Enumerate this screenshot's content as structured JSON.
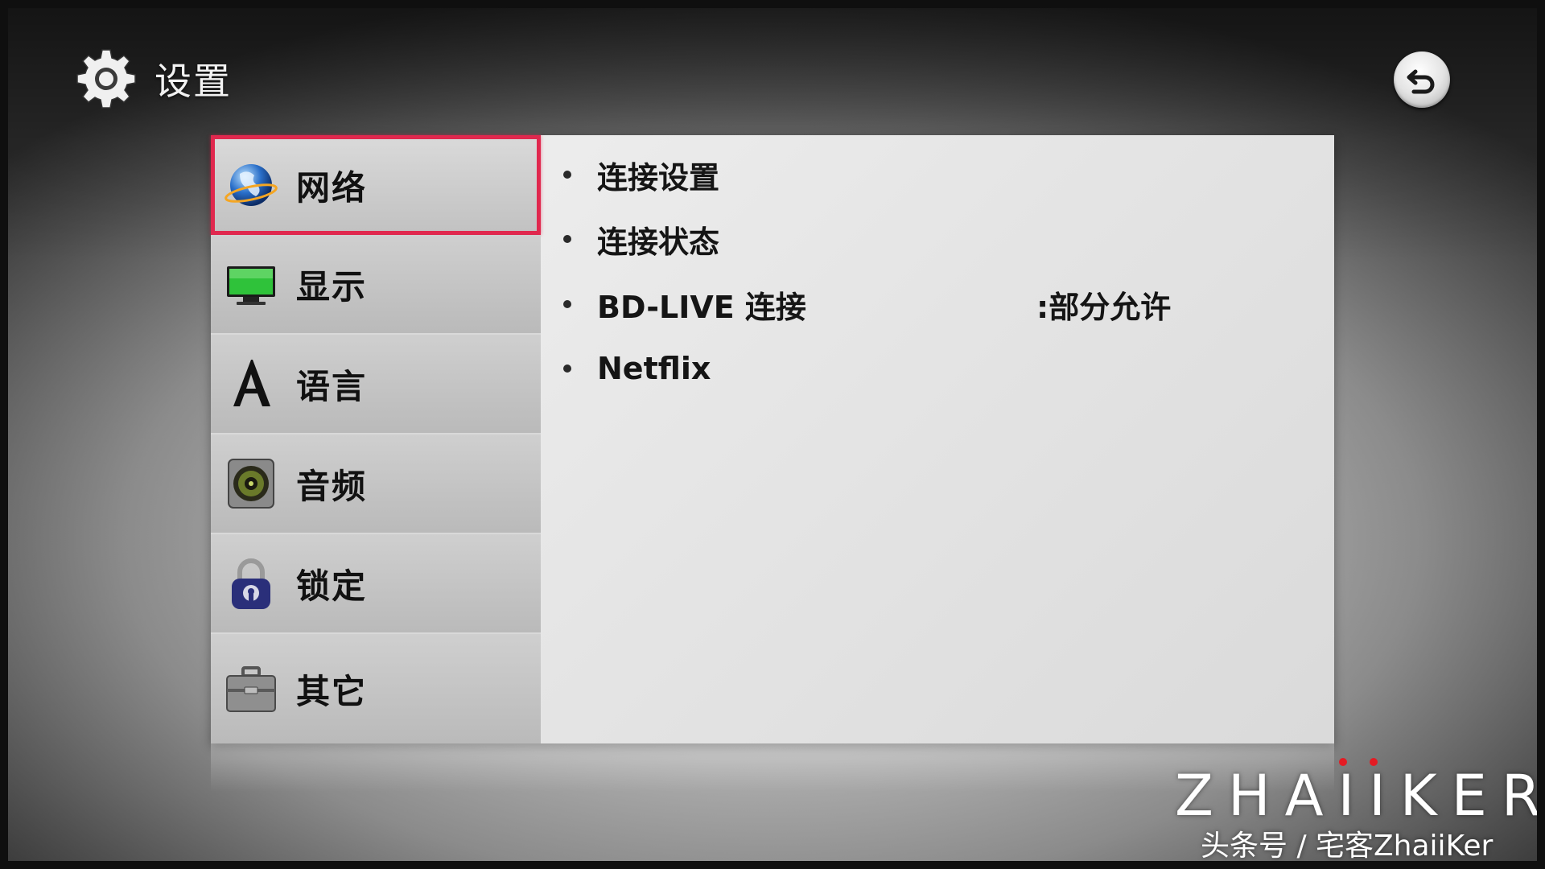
{
  "header": {
    "title": "设置",
    "icon": "gear-icon",
    "back_icon": "back-arrow-icon"
  },
  "sidebar": {
    "items": [
      {
        "label": "网络",
        "icon": "globe-icon",
        "selected": true
      },
      {
        "label": "显示",
        "icon": "monitor-icon",
        "selected": false
      },
      {
        "label": "语言",
        "icon": "letter-a-icon",
        "selected": false
      },
      {
        "label": "音频",
        "icon": "speaker-icon",
        "selected": false
      },
      {
        "label": "锁定",
        "icon": "padlock-icon",
        "selected": false
      },
      {
        "label": "其它",
        "icon": "toolbox-icon",
        "selected": false
      }
    ]
  },
  "content": {
    "options": [
      {
        "label": "连接设置",
        "value": ""
      },
      {
        "label": "连接状态",
        "value": ""
      },
      {
        "label": "BD-LIVE 连接",
        "value": ":部分允许"
      },
      {
        "label": "Netflix",
        "value": ""
      }
    ]
  },
  "watermark": {
    "logo": "ZHAIIKER",
    "subtitle": "头条号 / 宅客ZhaiiKer"
  },
  "colors": {
    "selection_border": "#e0284e",
    "watermark_dot": "#e31b23"
  }
}
